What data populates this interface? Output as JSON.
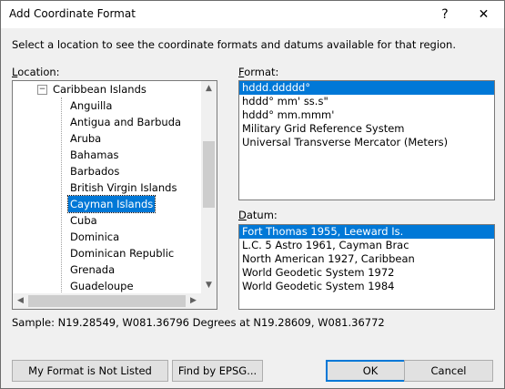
{
  "window": {
    "title": "Add Coordinate Format",
    "help_glyph": "?",
    "close_glyph": "✕"
  },
  "instructions": "Select a location to see the coordinate formats and datums available for that region.",
  "location": {
    "label_mnemonic": "L",
    "label_rest": "ocation:",
    "parent": "Caribbean Islands",
    "expander_glyph": "−",
    "items": [
      "Anguilla",
      "Antigua and Barbuda",
      "Aruba",
      "Bahamas",
      "Barbados",
      "British Virgin Islands",
      "Cayman Islands",
      "Cuba",
      "Dominica",
      "Dominican Republic",
      "Grenada",
      "Guadeloupe"
    ],
    "selected": "Cayman Islands"
  },
  "format": {
    "label_mnemonic": "F",
    "label_rest": "ormat:",
    "items": [
      "hddd.ddddd°",
      "hddd° mm' ss.s\"",
      "hddd° mm.mmm'",
      "Military Grid Reference System",
      "Universal Transverse Mercator (Meters)"
    ],
    "selected": "hddd.ddddd°"
  },
  "datum": {
    "label_mnemonic": "D",
    "label_rest": "atum:",
    "items": [
      "Fort Thomas 1955, Leeward Is.",
      "L.C. 5 Astro 1961, Cayman Brac",
      "North American 1927, Caribbean",
      "World Geodetic System 1972",
      "World Geodetic System 1984"
    ],
    "selected": "Fort Thomas 1955, Leeward Is."
  },
  "sample": "Sample: N19.28549, W081.36796 Degrees at N19.28609, W081.36772",
  "buttons": {
    "not_listed": "My Format is Not Listed",
    "find_epsg": "Find by EPSG...",
    "ok": "OK",
    "cancel": "Cancel"
  },
  "scroll_glyphs": {
    "up": "▲",
    "down": "▼",
    "left": "◀",
    "right": "▶"
  },
  "colors": {
    "selection": "#0078d7",
    "default_button_border": "#0078d7"
  }
}
